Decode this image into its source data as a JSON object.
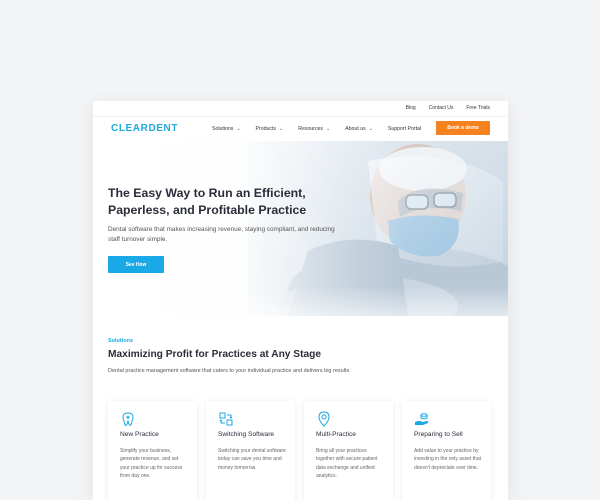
{
  "utility_bar": {
    "links": [
      "Blog",
      "Contact Us",
      "Free Trials"
    ]
  },
  "nav": {
    "logo": "CLEARDENT",
    "items": [
      {
        "label": "Solutions",
        "has_dropdown": true
      },
      {
        "label": "Products",
        "has_dropdown": true
      },
      {
        "label": "Resources",
        "has_dropdown": true
      },
      {
        "label": "About us",
        "has_dropdown": true
      },
      {
        "label": "Support Portal",
        "has_dropdown": false
      }
    ],
    "demo_button": "Book a demo"
  },
  "hero": {
    "title": "The Easy Way to Run an Efficient, Paperless, and Profitable Practice",
    "subtitle": "Dental software that makes increasing revenue, staying compliant, and reducing staff turnover simple.",
    "cta": "See How"
  },
  "solutions": {
    "eyebrow": "Solutions",
    "title": "Maximizing Profit for Practices at Any Stage",
    "subtitle": "Dental practice management software that caters to your individual practice and delivers big results",
    "cards": [
      {
        "icon": "tooth-heart-icon",
        "title": "New Practice",
        "description": "Simplify your business, generate revenue, and set your practice up for success from day one."
      },
      {
        "icon": "switch-arrows-icon",
        "title": "Switching Software",
        "description": "Switching your dental software today can save you time and money tomorrow."
      },
      {
        "icon": "location-pin-icon",
        "title": "Multi-Practice",
        "description": "Bring all your practices together with secure patient data exchange and unified analytics."
      },
      {
        "icon": "hand-coins-icon",
        "title": "Preparing to Sell",
        "description": "Add value to your practice by investing in the only asset that doesn't depreciate over time."
      }
    ]
  },
  "colors": {
    "brand": "#1eaadf",
    "cta_orange": "#f5821f",
    "cta_blue": "#18a9e6",
    "heading": "#2b2d3a"
  }
}
